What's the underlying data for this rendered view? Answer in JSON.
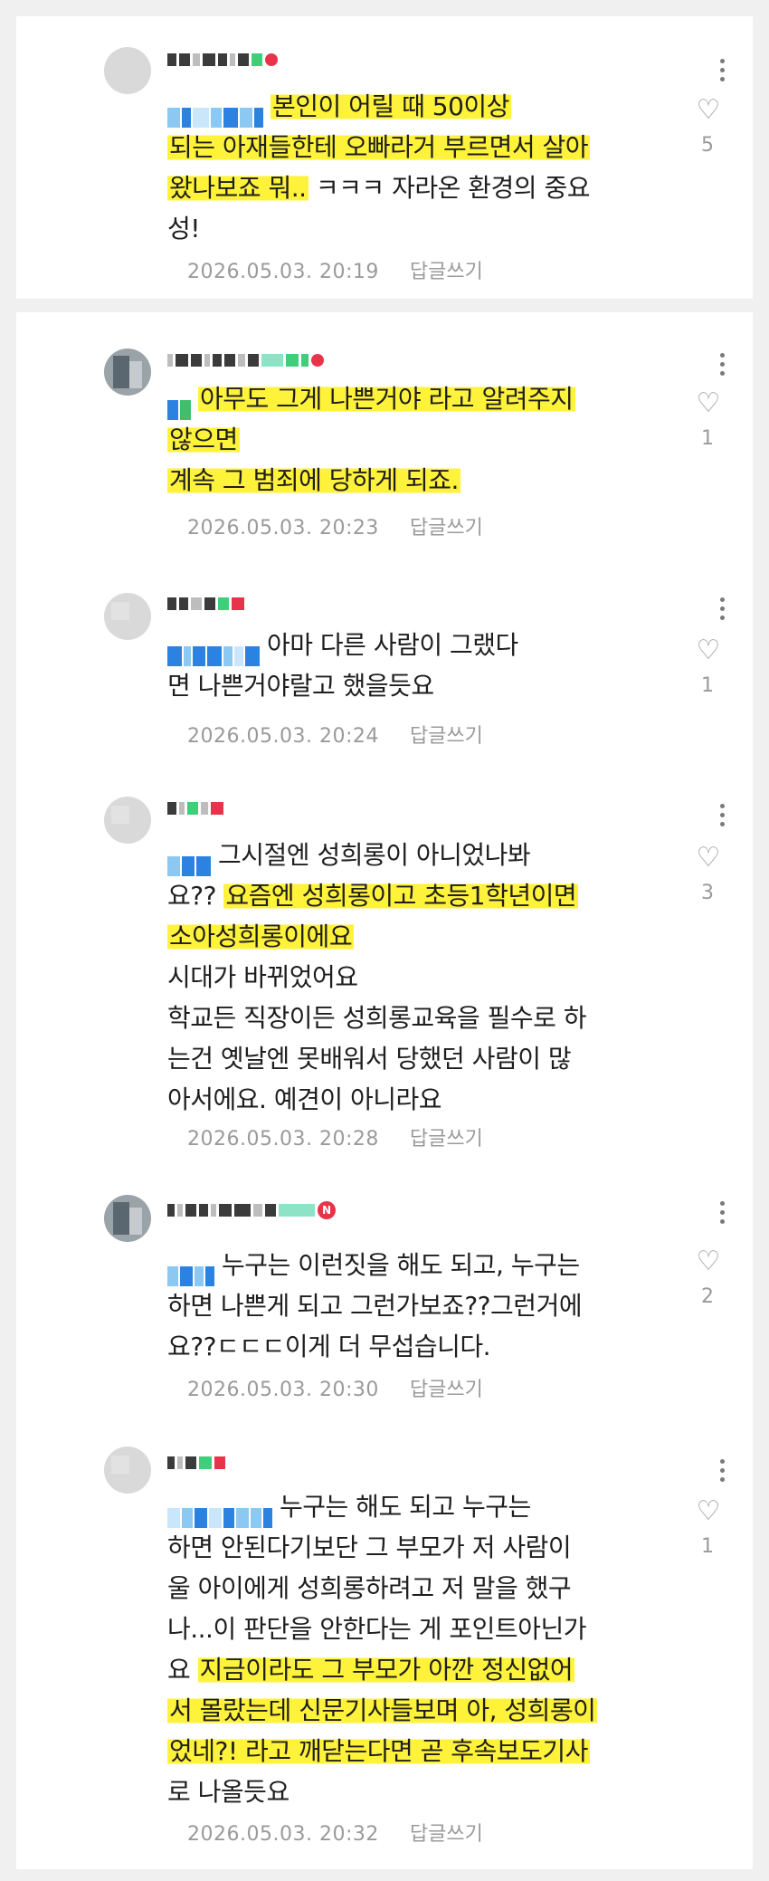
{
  "comments": [
    {
      "lines": [
        [
          "",
          "본인이 어릴 때 50이상"
        ],
        [
          "",
          "되는 아재들한테 오빠라거 부르면서 살아"
        ],
        [
          "",
          "왔나보죠 뭐.."
        ],
        [
          " ㅋㅋㅋ 자라온 환경의 중요",
          ""
        ],
        [
          "성!",
          ""
        ]
      ],
      "timestamp": "2026.05.03. 20:19",
      "reply_label": "답글쓰기",
      "likes": "5"
    },
    {
      "lines": [
        [
          "",
          "아무도 그게 나쁜거야 라고 알려주지"
        ],
        [
          "",
          "않으면"
        ],
        [
          "",
          "계속 그 범죄에 당하게 되죠."
        ]
      ],
      "timestamp": "2026.05.03. 20:23",
      "reply_label": "답글쓰기",
      "likes": "1"
    },
    {
      "lines": [
        [
          "아마 다른 사람이 그랬다",
          ""
        ],
        [
          "면 나쁜거야랄고 했을듯요",
          ""
        ]
      ],
      "timestamp": "2026.05.03. 20:24",
      "reply_label": "답글쓰기",
      "likes": "1"
    },
    {
      "lines": [
        [
          "그시절엔 성희롱이 아니었나봐",
          ""
        ],
        [
          "요?? ",
          "요즘엔 성희롱이고 초등1학년이면"
        ],
        [
          "",
          "소아성희롱이에요"
        ],
        [
          "시대가 바뀌었어요",
          ""
        ],
        [
          "학교든 직장이든 성희롱교육을 필수로 하",
          ""
        ],
        [
          "는건 옛날엔 못배워서 당했던 사람이 많",
          ""
        ],
        [
          "아서에요. 예견이 아니라요",
          ""
        ]
      ],
      "timestamp": "2026.05.03. 20:28",
      "reply_label": "답글쓰기",
      "likes": "3"
    },
    {
      "lines": [
        [
          "누구는 이런짓을 해도 되고, 누구는",
          ""
        ],
        [
          "하면 나쁜게 되고 그런가보죠??그런거에",
          ""
        ],
        [
          "요??ㄷㄷㄷ이게 더 무섭습니다.",
          ""
        ]
      ],
      "timestamp": "2026.05.03. 20:30",
      "reply_label": "답글쓰기",
      "likes": "2"
    },
    {
      "lines": [
        [
          "누구는 해도 되고 누구는",
          ""
        ],
        [
          "하면 안된다기보단 그 부모가 저 사람이",
          ""
        ],
        [
          "울 아이에게 성희롱하려고 저 말을 했구",
          ""
        ],
        [
          "나...이 판단을 안한다는 게 포인트아닌가",
          ""
        ],
        [
          "요 ",
          "지금이라도 그 부모가 아깐 정신없어"
        ],
        [
          "",
          "서 몰랐는데 신문기사들보며 아, 성희롱이"
        ],
        [
          "",
          "었네?! 라고 깨닫는다면 곧 후속보도기사"
        ],
        [
          "로 나올듯요",
          ""
        ]
      ],
      "timestamp": "2026.05.03. 20:32",
      "reply_label": "답글쓰기",
      "likes": "1"
    }
  ]
}
